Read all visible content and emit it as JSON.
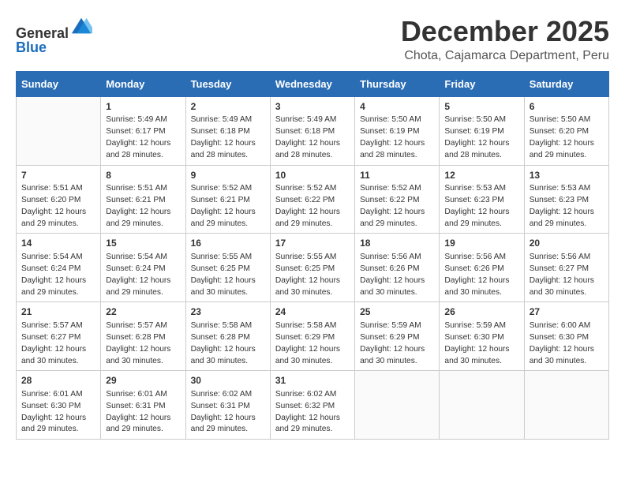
{
  "header": {
    "logo_general": "General",
    "logo_blue": "Blue",
    "month_title": "December 2025",
    "location": "Chota, Cajamarca Department, Peru"
  },
  "days_of_week": [
    "Sunday",
    "Monday",
    "Tuesday",
    "Wednesday",
    "Thursday",
    "Friday",
    "Saturday"
  ],
  "weeks": [
    [
      {
        "day": "",
        "info": ""
      },
      {
        "day": "1",
        "info": "Sunrise: 5:49 AM\nSunset: 6:17 PM\nDaylight: 12 hours\nand 28 minutes."
      },
      {
        "day": "2",
        "info": "Sunrise: 5:49 AM\nSunset: 6:18 PM\nDaylight: 12 hours\nand 28 minutes."
      },
      {
        "day": "3",
        "info": "Sunrise: 5:49 AM\nSunset: 6:18 PM\nDaylight: 12 hours\nand 28 minutes."
      },
      {
        "day": "4",
        "info": "Sunrise: 5:50 AM\nSunset: 6:19 PM\nDaylight: 12 hours\nand 28 minutes."
      },
      {
        "day": "5",
        "info": "Sunrise: 5:50 AM\nSunset: 6:19 PM\nDaylight: 12 hours\nand 28 minutes."
      },
      {
        "day": "6",
        "info": "Sunrise: 5:50 AM\nSunset: 6:20 PM\nDaylight: 12 hours\nand 29 minutes."
      }
    ],
    [
      {
        "day": "7",
        "info": "Sunrise: 5:51 AM\nSunset: 6:20 PM\nDaylight: 12 hours\nand 29 minutes."
      },
      {
        "day": "8",
        "info": "Sunrise: 5:51 AM\nSunset: 6:21 PM\nDaylight: 12 hours\nand 29 minutes."
      },
      {
        "day": "9",
        "info": "Sunrise: 5:52 AM\nSunset: 6:21 PM\nDaylight: 12 hours\nand 29 minutes."
      },
      {
        "day": "10",
        "info": "Sunrise: 5:52 AM\nSunset: 6:22 PM\nDaylight: 12 hours\nand 29 minutes."
      },
      {
        "day": "11",
        "info": "Sunrise: 5:52 AM\nSunset: 6:22 PM\nDaylight: 12 hours\nand 29 minutes."
      },
      {
        "day": "12",
        "info": "Sunrise: 5:53 AM\nSunset: 6:23 PM\nDaylight: 12 hours\nand 29 minutes."
      },
      {
        "day": "13",
        "info": "Sunrise: 5:53 AM\nSunset: 6:23 PM\nDaylight: 12 hours\nand 29 minutes."
      }
    ],
    [
      {
        "day": "14",
        "info": "Sunrise: 5:54 AM\nSunset: 6:24 PM\nDaylight: 12 hours\nand 29 minutes."
      },
      {
        "day": "15",
        "info": "Sunrise: 5:54 AM\nSunset: 6:24 PM\nDaylight: 12 hours\nand 29 minutes."
      },
      {
        "day": "16",
        "info": "Sunrise: 5:55 AM\nSunset: 6:25 PM\nDaylight: 12 hours\nand 30 minutes."
      },
      {
        "day": "17",
        "info": "Sunrise: 5:55 AM\nSunset: 6:25 PM\nDaylight: 12 hours\nand 30 minutes."
      },
      {
        "day": "18",
        "info": "Sunrise: 5:56 AM\nSunset: 6:26 PM\nDaylight: 12 hours\nand 30 minutes."
      },
      {
        "day": "19",
        "info": "Sunrise: 5:56 AM\nSunset: 6:26 PM\nDaylight: 12 hours\nand 30 minutes."
      },
      {
        "day": "20",
        "info": "Sunrise: 5:56 AM\nSunset: 6:27 PM\nDaylight: 12 hours\nand 30 minutes."
      }
    ],
    [
      {
        "day": "21",
        "info": "Sunrise: 5:57 AM\nSunset: 6:27 PM\nDaylight: 12 hours\nand 30 minutes."
      },
      {
        "day": "22",
        "info": "Sunrise: 5:57 AM\nSunset: 6:28 PM\nDaylight: 12 hours\nand 30 minutes."
      },
      {
        "day": "23",
        "info": "Sunrise: 5:58 AM\nSunset: 6:28 PM\nDaylight: 12 hours\nand 30 minutes."
      },
      {
        "day": "24",
        "info": "Sunrise: 5:58 AM\nSunset: 6:29 PM\nDaylight: 12 hours\nand 30 minutes."
      },
      {
        "day": "25",
        "info": "Sunrise: 5:59 AM\nSunset: 6:29 PM\nDaylight: 12 hours\nand 30 minutes."
      },
      {
        "day": "26",
        "info": "Sunrise: 5:59 AM\nSunset: 6:30 PM\nDaylight: 12 hours\nand 30 minutes."
      },
      {
        "day": "27",
        "info": "Sunrise: 6:00 AM\nSunset: 6:30 PM\nDaylight: 12 hours\nand 30 minutes."
      }
    ],
    [
      {
        "day": "28",
        "info": "Sunrise: 6:01 AM\nSunset: 6:30 PM\nDaylight: 12 hours\nand 29 minutes."
      },
      {
        "day": "29",
        "info": "Sunrise: 6:01 AM\nSunset: 6:31 PM\nDaylight: 12 hours\nand 29 minutes."
      },
      {
        "day": "30",
        "info": "Sunrise: 6:02 AM\nSunset: 6:31 PM\nDaylight: 12 hours\nand 29 minutes."
      },
      {
        "day": "31",
        "info": "Sunrise: 6:02 AM\nSunset: 6:32 PM\nDaylight: 12 hours\nand 29 minutes."
      },
      {
        "day": "",
        "info": ""
      },
      {
        "day": "",
        "info": ""
      },
      {
        "day": "",
        "info": ""
      }
    ]
  ]
}
